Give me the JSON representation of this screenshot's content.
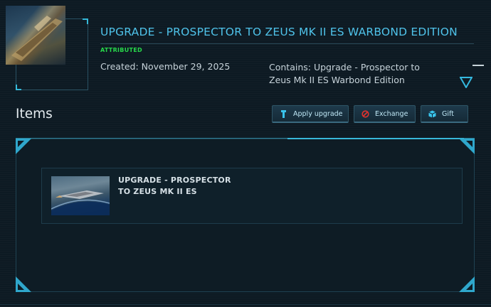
{
  "pledge": {
    "title": "UPGRADE - PROSPECTOR TO ZEUS MK II ES WARBOND EDITION",
    "status": "ATTRIBUTED",
    "created": "Created: November 29, 2025",
    "contains": "Contains: Upgrade - Prospector to Zeus Mk II ES Warbond Edition"
  },
  "items_section": {
    "label": "Items",
    "buttons": {
      "apply": "Apply upgrade",
      "exchange": "Exchange",
      "gift": "Gift"
    }
  },
  "items": [
    {
      "name": "UPGRADE - PROSPECTOR TO ZEUS MK II ES"
    }
  ],
  "colors": {
    "accent": "#4fc3ea",
    "status_green": "#27d94a",
    "background": "#0d1a23"
  },
  "icons": [
    "minimize-icon",
    "expand-icon",
    "wrench-icon",
    "exchange-icon",
    "gift-icon"
  ]
}
